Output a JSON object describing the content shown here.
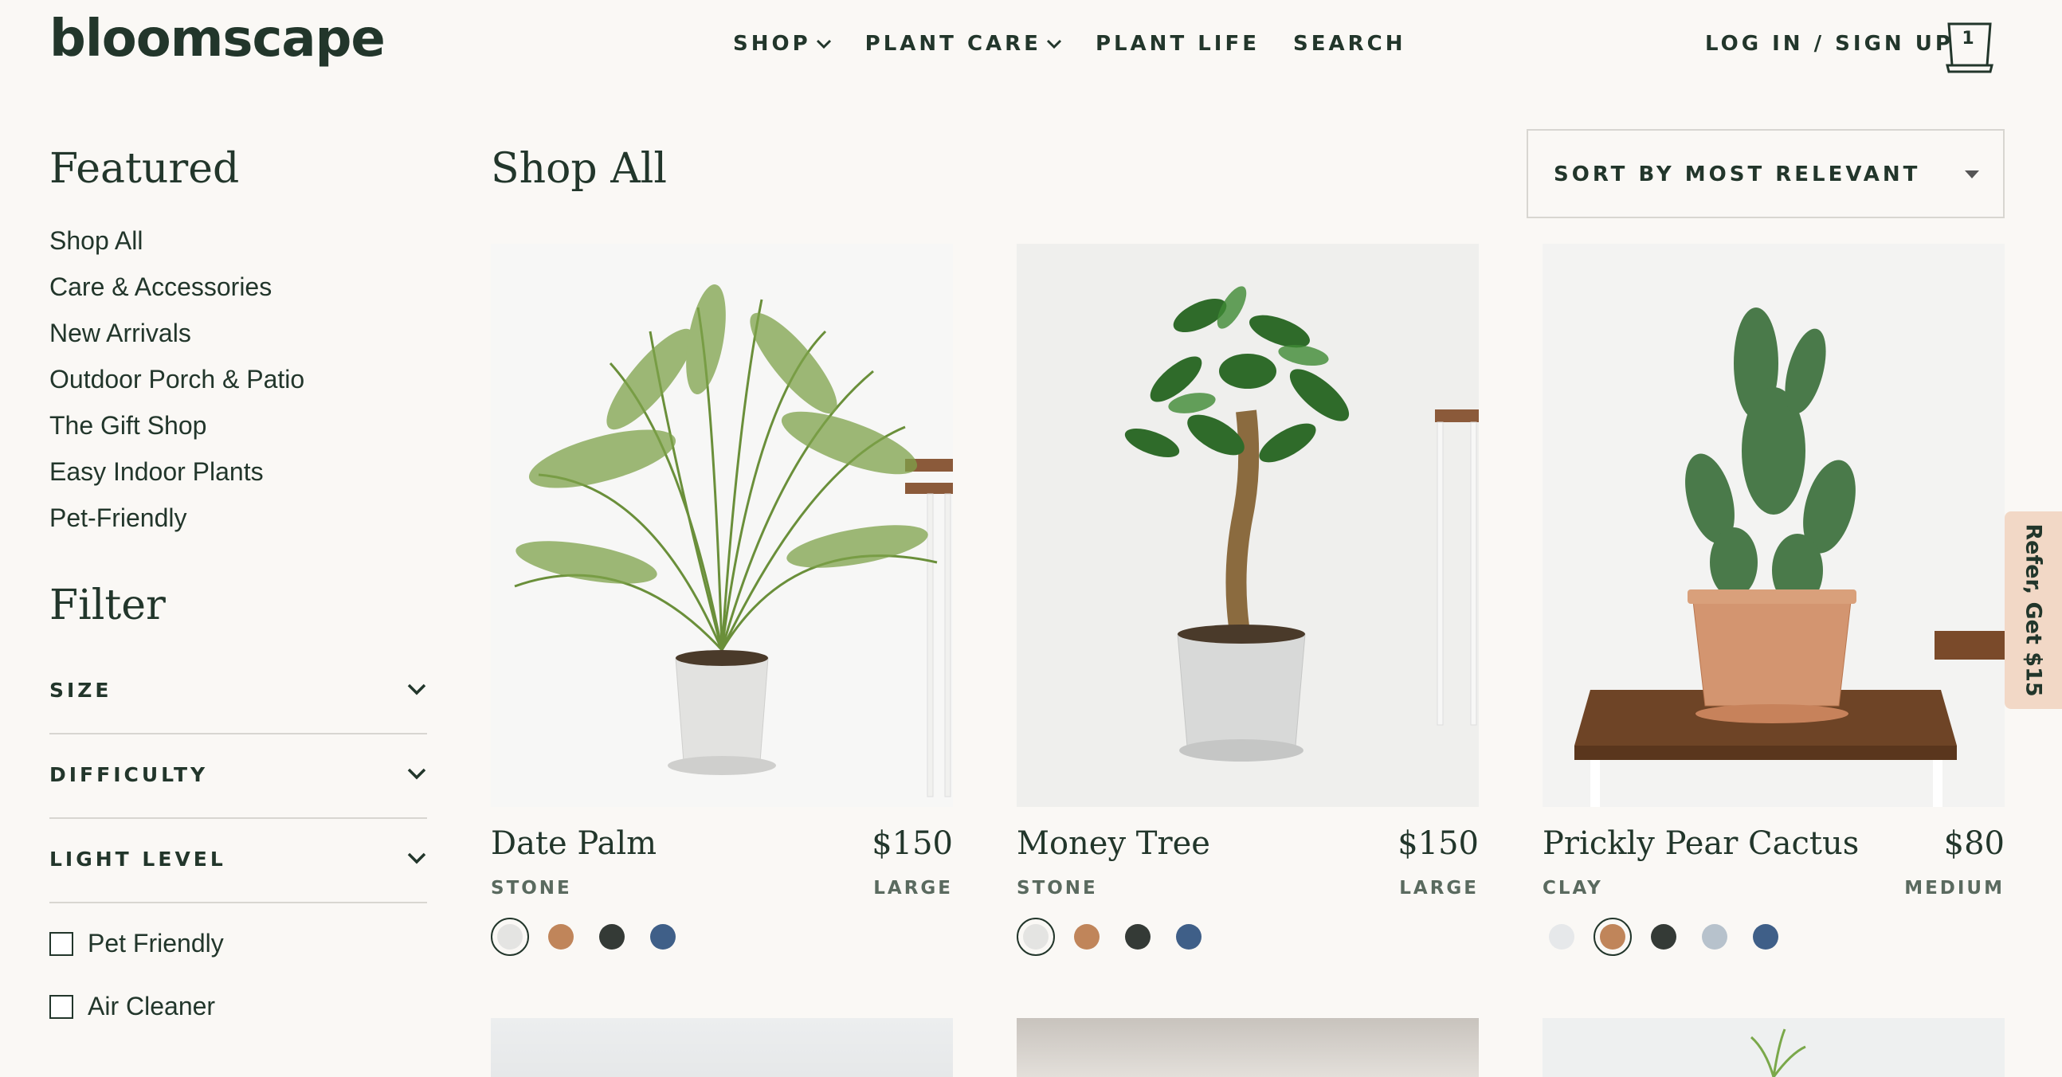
{
  "brand": {
    "logo_text": "bloomscape"
  },
  "nav": {
    "items": [
      {
        "label": "SHOP",
        "has_dropdown": true
      },
      {
        "label": "PLANT CARE",
        "has_dropdown": true
      },
      {
        "label": "PLANT LIFE",
        "has_dropdown": false
      },
      {
        "label": "SEARCH",
        "has_dropdown": false
      }
    ],
    "login_label": "LOG IN / SIGN UP",
    "cart_count": "1"
  },
  "sidebar": {
    "featured_title": "Featured",
    "featured_links": [
      "Shop All",
      "Care & Accessories",
      "New Arrivals",
      "Outdoor Porch & Patio",
      "The Gift Shop",
      "Easy Indoor Plants",
      "Pet-Friendly"
    ],
    "filter_title": "Filter",
    "filter_groups": [
      "SIZE",
      "DIFFICULTY",
      "LIGHT LEVEL"
    ],
    "checkboxes": [
      {
        "label": "Pet Friendly",
        "checked": false
      },
      {
        "label": "Air Cleaner",
        "checked": false
      }
    ]
  },
  "main": {
    "title": "Shop All",
    "sort_label": "SORT BY MOST RELEVANT",
    "products": [
      {
        "name": "Date Palm",
        "price": "$150",
        "color": "STONE",
        "size": "LARGE",
        "swatches": [
          {
            "color": "#e4e4e2",
            "selected": true
          },
          {
            "color": "#c0855a",
            "selected": false
          },
          {
            "color": "#343a36",
            "selected": false
          },
          {
            "color": "#3f5f88",
            "selected": false
          }
        ]
      },
      {
        "name": "Money Tree",
        "price": "$150",
        "color": "STONE",
        "size": "LARGE",
        "swatches": [
          {
            "color": "#e4e4e2",
            "selected": true
          },
          {
            "color": "#c0855a",
            "selected": false
          },
          {
            "color": "#343a36",
            "selected": false
          },
          {
            "color": "#3f5f88",
            "selected": false
          }
        ]
      },
      {
        "name": "Prickly Pear Cactus",
        "price": "$80",
        "color": "CLAY",
        "size": "MEDIUM",
        "swatches": [
          {
            "color": "#e6e8ea",
            "selected": false
          },
          {
            "color": "#c0855a",
            "selected": true
          },
          {
            "color": "#343a36",
            "selected": false
          },
          {
            "color": "#b7c2cc",
            "selected": false
          },
          {
            "color": "#3f5f88",
            "selected": false
          }
        ]
      }
    ]
  },
  "refer_tab": {
    "label": "Refer, Get $15"
  },
  "colors": {
    "brand_green": "#22362b",
    "background": "#faf8f5",
    "refer_bg": "#f2d8c6"
  }
}
